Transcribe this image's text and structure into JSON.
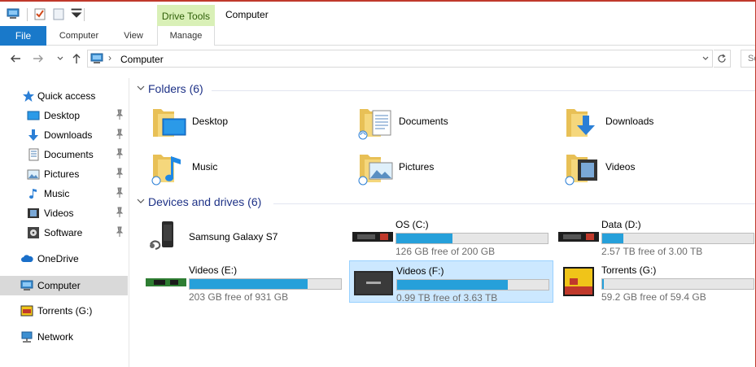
{
  "title_bar": {
    "context_tab": "Drive Tools",
    "window_title": "Computer",
    "icons": [
      "computer-icon",
      "properties-icon",
      "new-folder-icon",
      "customize-dropdown-icon"
    ]
  },
  "ribbon": {
    "file_label": "File",
    "tabs": [
      {
        "label": "Computer"
      },
      {
        "label": "View"
      },
      {
        "label": "Manage"
      }
    ]
  },
  "address_bar": {
    "path": "Computer",
    "separator": "›",
    "search_placeholder": "Se"
  },
  "navigation_pane": {
    "quick_access_label": "Quick access",
    "quick_access_items": [
      {
        "label": "Desktop",
        "icon": "desktop-icon",
        "pinned": true
      },
      {
        "label": "Downloads",
        "icon": "downloads-icon",
        "pinned": true
      },
      {
        "label": "Documents",
        "icon": "documents-icon",
        "pinned": true
      },
      {
        "label": "Pictures",
        "icon": "pictures-icon",
        "pinned": true
      },
      {
        "label": "Music",
        "icon": "music-icon",
        "pinned": true
      },
      {
        "label": "Videos",
        "icon": "videos-icon",
        "pinned": true
      },
      {
        "label": "Software",
        "icon": "software-icon",
        "pinned": true
      }
    ],
    "onedrive_label": "OneDrive",
    "computer_label": "Computer",
    "torrents_label": "Torrents (G:)",
    "network_label": "Network"
  },
  "content": {
    "folders_header": "Folders (6)",
    "folders": [
      {
        "label": "Desktop",
        "overlay": "desktop"
      },
      {
        "label": "Documents",
        "overlay": "documents"
      },
      {
        "label": "Downloads",
        "overlay": "downloads"
      },
      {
        "label": "Music",
        "overlay": "music"
      },
      {
        "label": "Pictures",
        "overlay": "pictures"
      },
      {
        "label": "Videos",
        "overlay": "videos"
      }
    ],
    "devices_header": "Devices and drives (6)",
    "drives": [
      {
        "name": "Samsung Galaxy S7",
        "icon": "phone-icon",
        "has_bar": false
      },
      {
        "name": "OS (C:)",
        "icon": "ssd-icon",
        "has_bar": true,
        "free": "126 GB free of 200 GB",
        "used_fraction": 0.37
      },
      {
        "name": "Data (D:)",
        "icon": "ssd-icon",
        "has_bar": true,
        "free": "2.57 TB free of 3.00 TB",
        "used_fraction": 0.14
      },
      {
        "name": "Videos (E:)",
        "icon": "m2-drive-icon",
        "has_bar": true,
        "free": "203 GB free of 931 GB",
        "used_fraction": 0.78
      },
      {
        "name": "Videos (F:)",
        "icon": "samsung-ssd-icon",
        "has_bar": true,
        "free": "0.99 TB free of 3.63 TB",
        "used_fraction": 0.73,
        "selected": true
      },
      {
        "name": "Torrents (G:)",
        "icon": "sd-card-icon",
        "has_bar": true,
        "free": "59.2 GB free of 59.4 GB",
        "used_fraction": 0.01
      }
    ]
  },
  "colors": {
    "file_tab": "#1979ca",
    "drive_tools": "#d9f0b7",
    "group_header": "#1e3287",
    "bar_fill": "#26a0da",
    "selection": "#cce8ff"
  }
}
